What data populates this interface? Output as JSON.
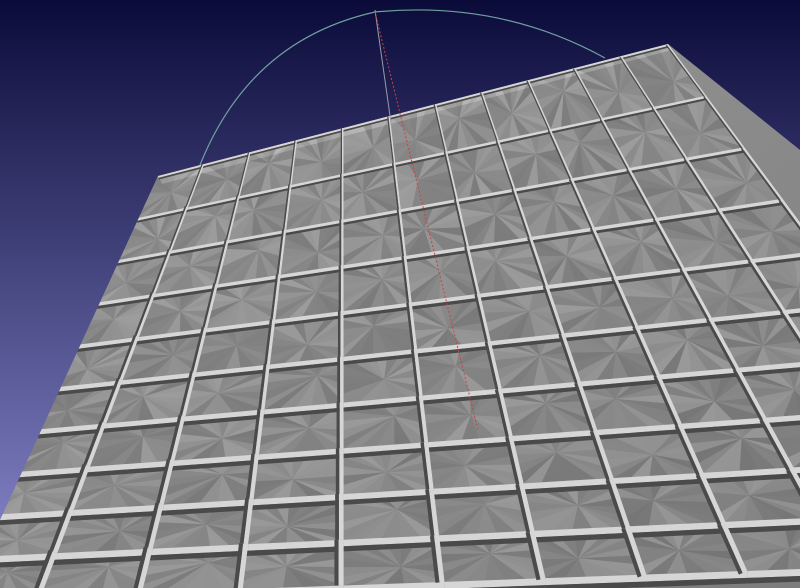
{
  "viewport": {
    "background_top": "#0b0b3a",
    "background_bottom": "#8a8ad0",
    "mesh_face_color": "#8a8a8a",
    "mesh_shadow_color": "#4a4a4a",
    "mesh_highlight_color": "#d6d6d6",
    "trackball_arc_color": "#6fa0a0",
    "axis_red_color": "#d04040",
    "axis_gray_color": "#9a9aa8"
  }
}
